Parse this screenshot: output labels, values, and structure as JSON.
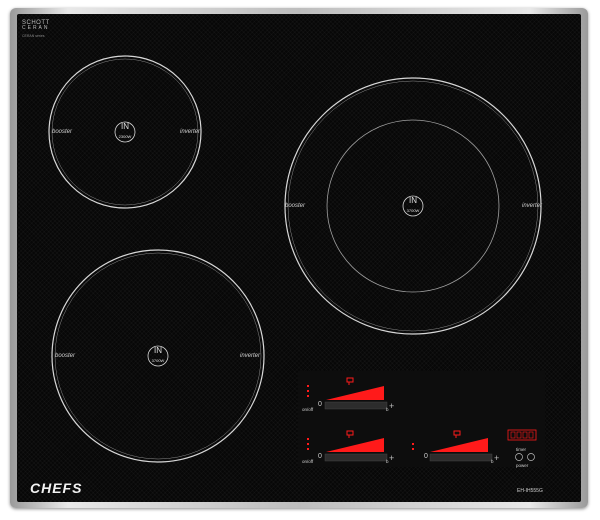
{
  "brand_top": {
    "line1": "SCHOTT",
    "line2": "CERAN",
    "line3": "CERAN series"
  },
  "zones": [
    {
      "id": "top-left",
      "center_text": "IN",
      "power": "2300W",
      "left_label": "booster",
      "right_label": "inverter"
    },
    {
      "id": "bottom-left",
      "center_text": "IN",
      "power": "3700W",
      "left_label": "booster",
      "right_label": "inverter"
    },
    {
      "id": "right",
      "center_text": "IN",
      "power": "3700W",
      "left_label": "booster",
      "right_label": "inverter"
    }
  ],
  "controls": {
    "zone_controls": [
      {
        "id": "top-left-control",
        "zero": "0",
        "plus": "+",
        "b": "b",
        "word": "on/off"
      },
      {
        "id": "bottom-left-control",
        "zero": "0",
        "plus": "+",
        "b": "b",
        "word": "on/off"
      },
      {
        "id": "right-control",
        "zero": "0",
        "plus": "+",
        "b": "b"
      }
    ],
    "timer": {
      "word": "timer"
    },
    "power_word": "power"
  },
  "logo": "CHEFS",
  "model": "EH-IH555G",
  "colors": {
    "glass": "#070707",
    "accent_red": "#ff1a1a",
    "frame": "#cfcfcf"
  }
}
